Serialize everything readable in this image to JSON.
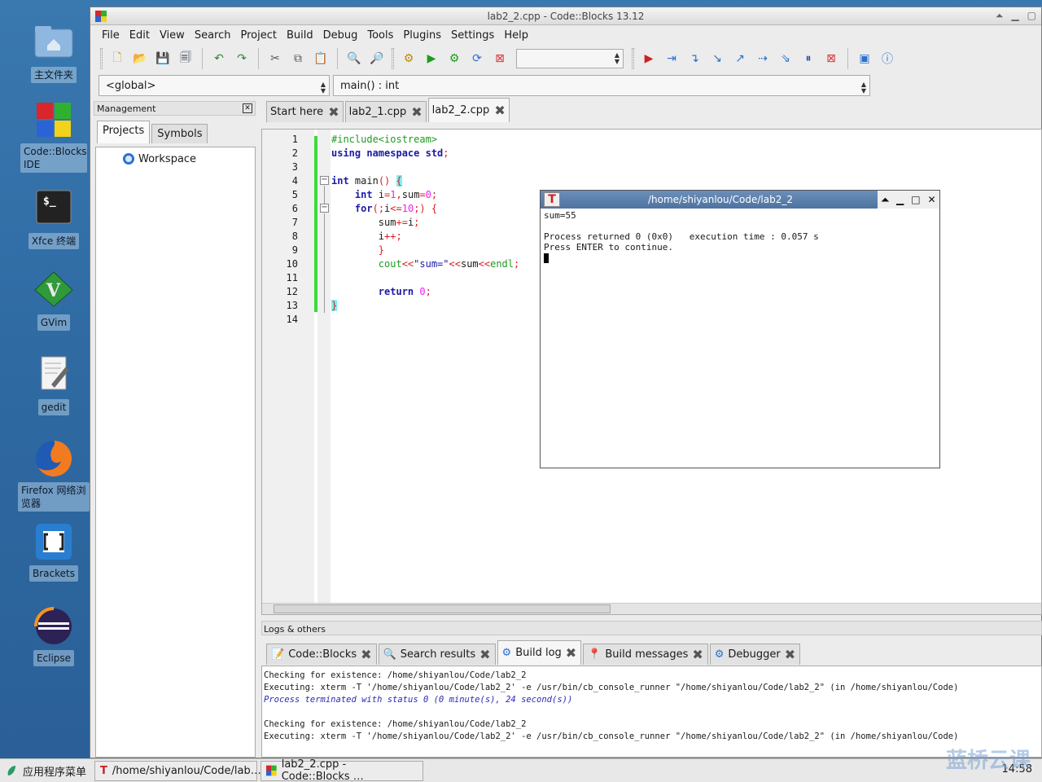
{
  "desktop": {
    "icons": [
      {
        "label": "主文件夹",
        "icon": "home-folder-icon"
      },
      {
        "label": "Code::Blocks IDE",
        "icon": "codeblocks-icon"
      },
      {
        "label": "Xfce 终端",
        "icon": "terminal-icon"
      },
      {
        "label": "GVim",
        "icon": "gvim-icon"
      },
      {
        "label": "gedit",
        "icon": "gedit-icon"
      },
      {
        "label": "Firefox 网络浏览器",
        "icon": "firefox-icon"
      },
      {
        "label": "Brackets",
        "icon": "brackets-icon"
      },
      {
        "label": "Eclipse",
        "icon": "eclipse-icon"
      }
    ],
    "terminal_prompt": "$_"
  },
  "window": {
    "title": "lab2_2.cpp - Code::Blocks 13.12"
  },
  "menu": [
    "File",
    "Edit",
    "View",
    "Search",
    "Project",
    "Build",
    "Debug",
    "Tools",
    "Plugins",
    "Settings",
    "Help"
  ],
  "scope": {
    "global": "<global>",
    "function": "main() : int"
  },
  "management": {
    "title": "Management",
    "tabs": [
      "Projects",
      "Symbols"
    ],
    "tree_root": "Workspace"
  },
  "editor": {
    "tabs": [
      "Start here",
      "lab2_1.cpp",
      "lab2_2.cpp"
    ],
    "active_tab": "lab2_2.cpp",
    "line_numbers": [
      "1",
      "2",
      "3",
      "4",
      "5",
      "6",
      "7",
      "8",
      "9",
      "10",
      "11",
      "12",
      "13",
      "14"
    ]
  },
  "terminal": {
    "title": "/home/shiyanlou/Code/lab2_2",
    "icon_glyph": "T",
    "output": [
      "sum=55",
      "",
      "Process returned 0 (0x0)   execution time : 0.057 s",
      "Press ENTER to continue."
    ]
  },
  "logs": {
    "title": "Logs & others",
    "tabs": [
      "Code::Blocks",
      "Search results",
      "Build log",
      "Build messages",
      "Debugger"
    ],
    "active_tab": "Build log",
    "lines": [
      "Checking for existence: /home/shiyanlou/Code/lab2_2",
      "Executing: xterm -T '/home/shiyanlou/Code/lab2_2' -e /usr/bin/cb_console_runner \"/home/shiyanlou/Code/lab2_2\" (in /home/shiyanlou/Code)",
      "Process terminated with status 0 (0 minute(s), 24 second(s))",
      "",
      "Checking for existence: /home/shiyanlou/Code/lab2_2",
      "Executing: xterm -T '/home/shiyanlou/Code/lab2_2' -e /usr/bin/cb_console_runner \"/home/shiyanlou/Code/lab2_2\" (in /home/shiyanlou/Code)"
    ]
  },
  "taskbar": {
    "menu_label": "应用程序菜单",
    "tasks": [
      "/home/shiyanlou/Code/lab…",
      "lab2_2.cpp - Code::Blocks …"
    ],
    "clock": "14:58",
    "watermark": "蓝桥云课"
  },
  "colors": {
    "accent": "#4f73a0",
    "changebar": "#3adb3a",
    "keyword": "#1a1aa8",
    "preprocessor": "#1f9a1f"
  }
}
